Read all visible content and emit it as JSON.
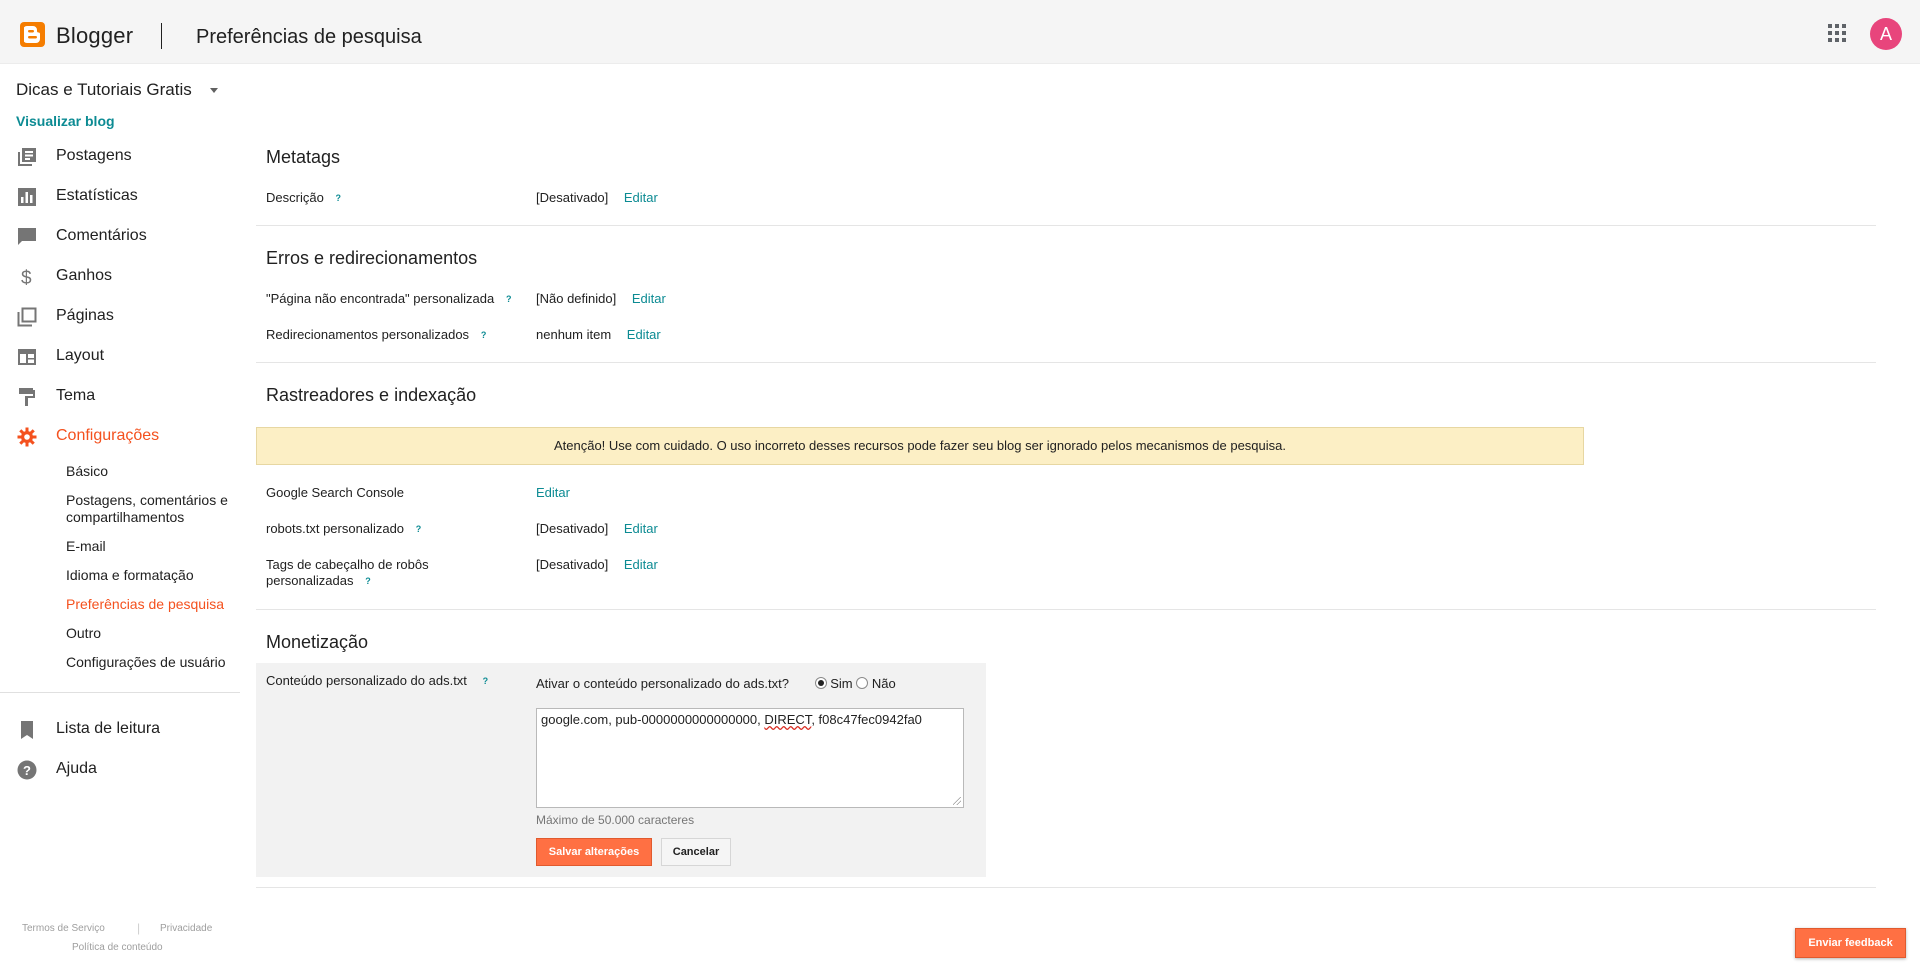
{
  "header": {
    "brand": "Blogger",
    "page_title": "Preferências de pesquisa",
    "avatar_letter": "A",
    "brand_color": "#f57d00"
  },
  "sidebar": {
    "blog_name": "Dicas e Tutoriais Gratis",
    "view_blog": "Visualizar blog",
    "nav": [
      {
        "label": "Postagens",
        "icon": "posts-icon"
      },
      {
        "label": "Estatísticas",
        "icon": "stats-icon"
      },
      {
        "label": "Comentários",
        "icon": "comments-icon"
      },
      {
        "label": "Ganhos",
        "icon": "dollar-icon"
      },
      {
        "label": "Páginas",
        "icon": "pages-icon"
      },
      {
        "label": "Layout",
        "icon": "layout-icon"
      },
      {
        "label": "Tema",
        "icon": "paint-roller-icon"
      },
      {
        "label": "Configurações",
        "icon": "gear-icon",
        "active": true
      }
    ],
    "settings_sub": [
      {
        "label": "Básico"
      },
      {
        "label": "Postagens, comentários e compartilhamentos"
      },
      {
        "label": "E-mail"
      },
      {
        "label": "Idioma e formatação"
      },
      {
        "label": "Preferências de pesquisa",
        "active": true
      },
      {
        "label": "Outro"
      },
      {
        "label": "Configurações de usuário"
      }
    ],
    "nav_bottom": [
      {
        "label": "Lista de leitura",
        "icon": "bookmark-icon"
      },
      {
        "label": "Ajuda",
        "icon": "help-icon"
      }
    ],
    "footer": {
      "terms": "Termos de Serviço",
      "privacy": "Privacidade",
      "content_policy": "Política de conteúdo"
    }
  },
  "main": {
    "metatags": {
      "title": "Metatags",
      "description_label": "Descrição",
      "description_value": "[Desativado]",
      "edit": "Editar"
    },
    "errors": {
      "title": "Erros e redirecionamentos",
      "not_found_label": "\"Página não encontrada\" personalizada",
      "not_found_value": "[Não definido]",
      "redirects_label": "Redirecionamentos personalizados",
      "redirects_value": "nenhum item",
      "edit": "Editar"
    },
    "crawlers": {
      "title": "Rastreadores e indexação",
      "warning": "Atenção! Use com cuidado. O uso incorreto desses recursos pode fazer seu blog ser ignorado pelos mecanismos de pesquisa.",
      "search_console_label": "Google Search Console",
      "robots_label": "robots.txt personalizado",
      "robots_value": "[Desativado]",
      "robot_tags_label": "Tags de cabeçalho de robôs personalizadas",
      "robot_tags_value": "[Desativado]",
      "edit": "Editar"
    },
    "monetization": {
      "title": "Monetização",
      "ads_label": "Conteúdo personalizado do ads.txt",
      "enable_question": "Ativar o conteúdo personalizado do ads.txt?",
      "yes": "Sim",
      "no": "Não",
      "selected": "Sim",
      "ads_text_before": "google.com, pub-0000000000000000, ",
      "ads_text_direct": "DIRECT",
      "ads_text_after": ", f08c47fec0942fa0",
      "max_chars": "Máximo de 50.000 caracteres",
      "save": "Salvar alterações",
      "cancel": "Cancelar"
    },
    "help_glyph": "?"
  },
  "feedback_button": "Enviar feedback",
  "colors": {
    "accent": "#f4511e",
    "link": "#0c8b93",
    "warning_bg": "#fcefc5",
    "button": "#ff7043"
  }
}
